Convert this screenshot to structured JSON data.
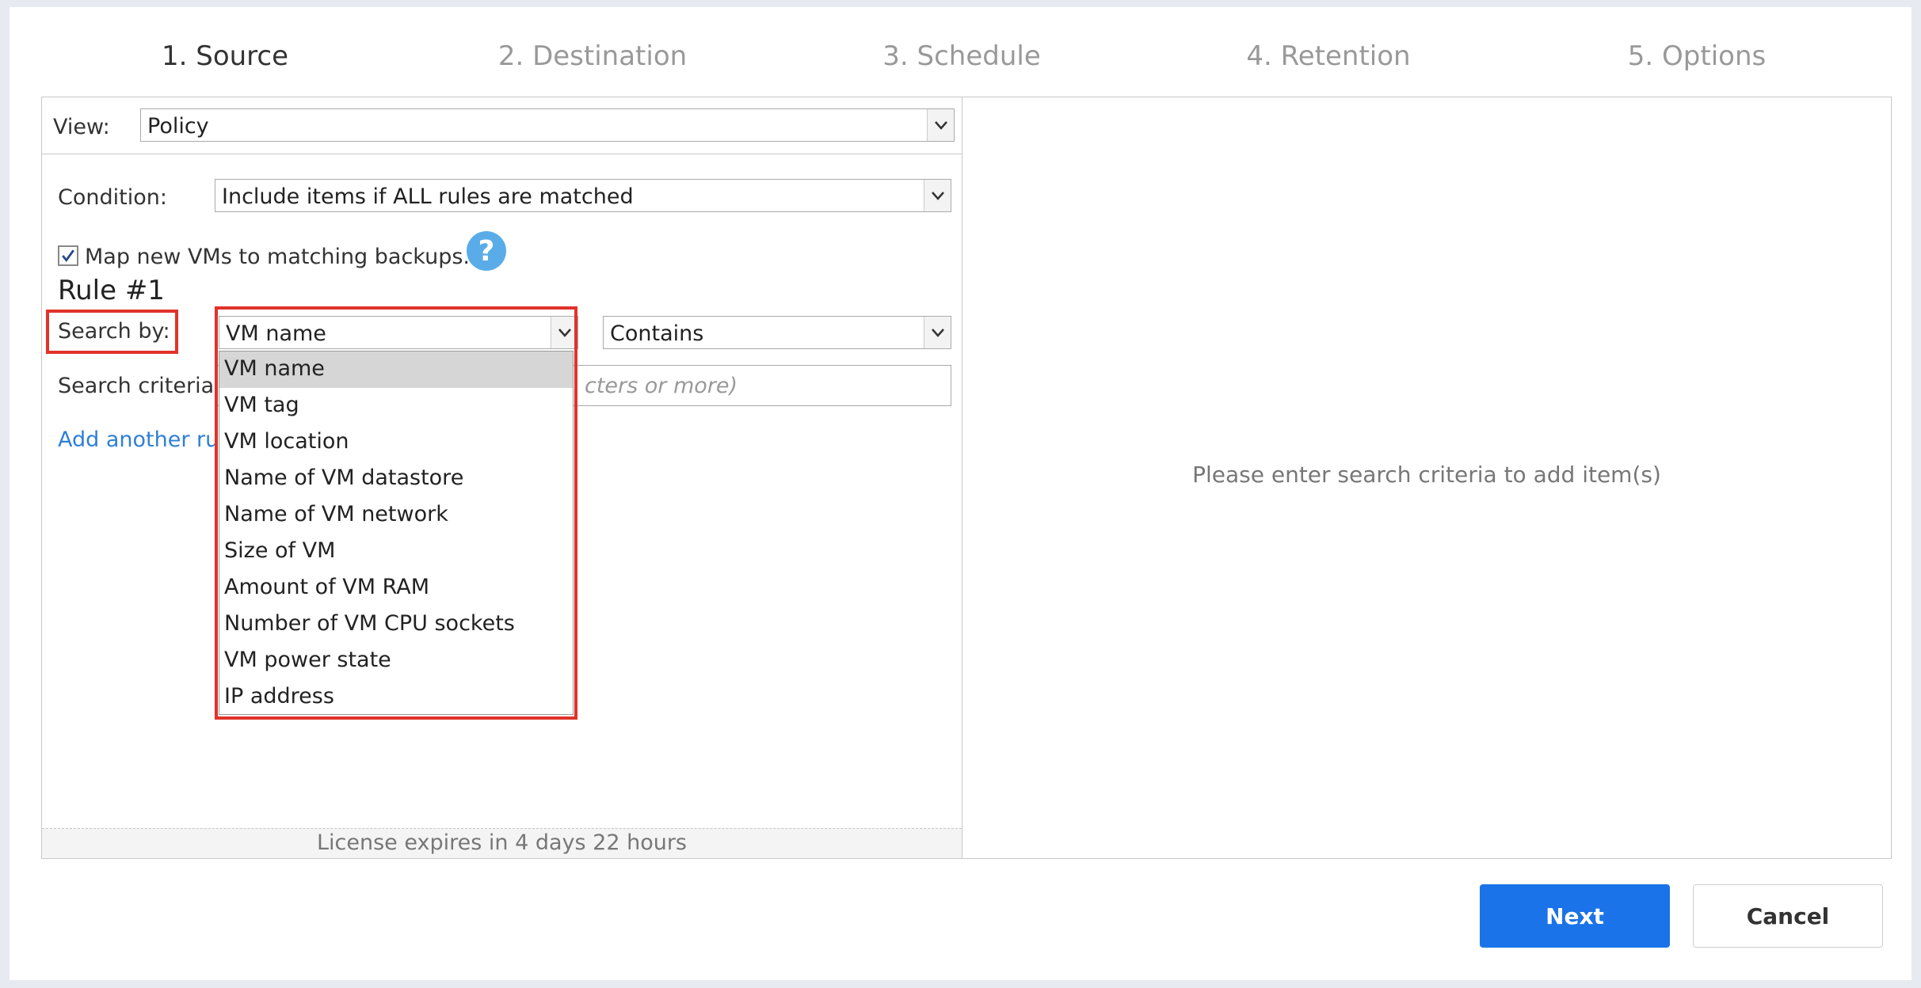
{
  "wizard": {
    "steps": [
      "1. Source",
      "2. Destination",
      "3. Schedule",
      "4. Retention",
      "5. Options"
    ]
  },
  "view": {
    "label": "View:",
    "value": "Policy"
  },
  "condition": {
    "label": "Condition:",
    "value": "Include items if ALL rules are matched"
  },
  "map_option": {
    "label": "Map new VMs to matching backups.",
    "checked": true
  },
  "rule": {
    "title": "Rule #1",
    "search_by_label": "Search by:",
    "search_by_value": "VM name",
    "operator_value": "Contains",
    "search_criteria_label": "Search criteria:",
    "search_criteria_placeholder": "cters or more)",
    "add_rule_link": "Add another rule",
    "search_by_options": [
      "VM name",
      "VM tag",
      "VM location",
      "Name of VM datastore",
      "Name of VM network",
      "Size of VM",
      "Amount of VM RAM",
      "Number of VM CPU sockets",
      "VM power state",
      "IP address"
    ]
  },
  "right_panel": {
    "empty_message": "Please enter search criteria to add item(s)"
  },
  "license": {
    "text": "License expires in 4 days 22 hours"
  },
  "buttons": {
    "next": "Next",
    "cancel": "Cancel"
  },
  "colors": {
    "accent": "#1a73e8",
    "highlight": "#e0332a",
    "help": "#5aace9"
  }
}
